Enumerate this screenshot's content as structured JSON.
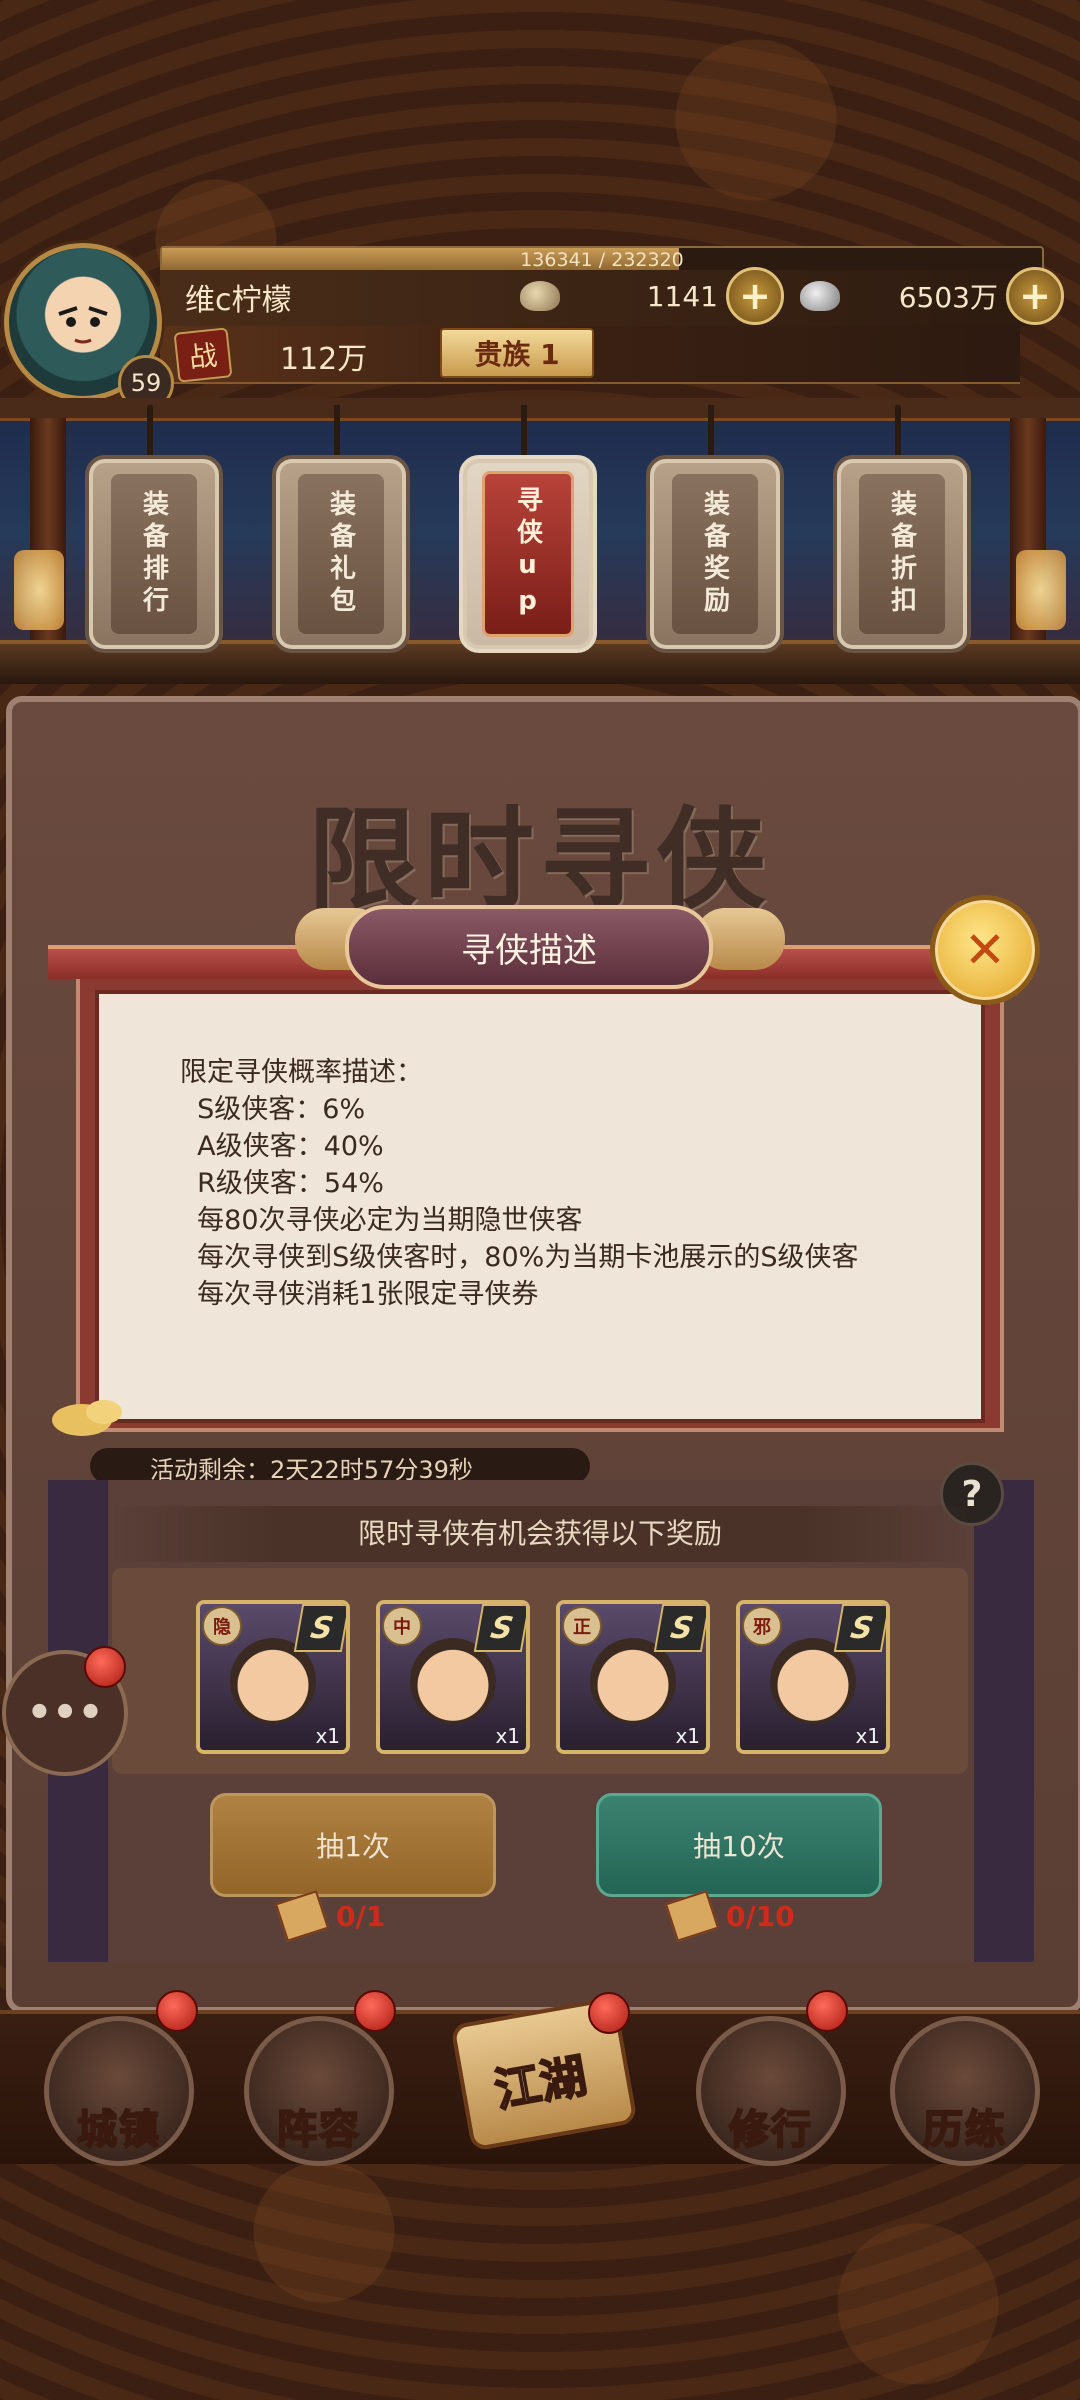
{
  "player": {
    "exp_text": "136341 / 232320",
    "exp_fraction": 0.587,
    "name": "维c柠檬",
    "level": "59",
    "power_label": "战",
    "power_value": "112万",
    "noble_label": "贵族 1"
  },
  "currency": {
    "ingot": "1141",
    "silver": "6503万",
    "plus": "+"
  },
  "tabs": [
    {
      "label": "装备排行",
      "active": false
    },
    {
      "label": "装备礼包",
      "active": false
    },
    {
      "label": "寻侠up",
      "active": true
    },
    {
      "label": "装备奖励",
      "active": false
    },
    {
      "label": "装备折扣",
      "active": false
    }
  ],
  "banner_title": "限时寻侠",
  "activity": {
    "remaining_text": "活动剩余：2天22时57分39秒",
    "help": "?"
  },
  "rewards": {
    "header": "限时寻侠有机会获得以下奖励",
    "heroes": [
      {
        "tag": "隐",
        "rank": "S",
        "qty": "x1"
      },
      {
        "tag": "中",
        "rank": "S",
        "qty": "x1"
      },
      {
        "tag": "正",
        "rank": "S",
        "qty": "x1"
      },
      {
        "tag": "邪",
        "rank": "S",
        "qty": "x1"
      }
    ]
  },
  "draw": {
    "one_label": "抽1次",
    "ten_label": "抽10次",
    "one_ticket": "0/1",
    "ten_ticket": "0/10"
  },
  "chat": {
    "icon": "chat-bubble-icon",
    "glyph": "•••"
  },
  "modal": {
    "title": "寻侠描述",
    "close_glyph": "✕",
    "lines": [
      "限定寻侠概率描述：",
      "  S级侠客：6%",
      "  A级侠客：40%",
      "  R级侠客：54%",
      "  每80次寻侠必定为当期隐世侠客",
      "  每次寻侠到S级侠客时，80%为当期卡池展示的S级侠客",
      "  每次寻侠消耗1张限定寻侠券"
    ]
  },
  "bottom_nav": [
    {
      "label": "城镇"
    },
    {
      "label": "阵容"
    },
    {
      "label": "江湖"
    },
    {
      "label": "修行"
    },
    {
      "label": "历练"
    }
  ]
}
